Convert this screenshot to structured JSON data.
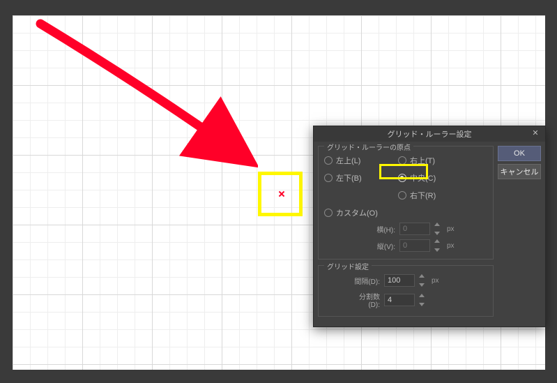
{
  "dialog": {
    "title": "グリッド・ルーラー設定",
    "ok": "OK",
    "cancel": "キャンセル"
  },
  "origin": {
    "groupTitle": "グリッド・ルーラーの原点",
    "topLeft": "左上(L)",
    "topRight": "右上(T)",
    "bottomLeft": "左下(B)",
    "center": "中央(C)",
    "bottomRight": "右下(R)",
    "custom": "カスタム(O)",
    "hLabel": "横(H):",
    "hValue": "0",
    "vLabel": "縦(V):",
    "vValue": "0",
    "unit": "px"
  },
  "grid": {
    "groupTitle": "グリッド設定",
    "spacingLabel": "間隔(D):",
    "spacingValue": "100",
    "spacingUnit": "px",
    "divLabel": "分割数(D):",
    "divValue": "4"
  }
}
